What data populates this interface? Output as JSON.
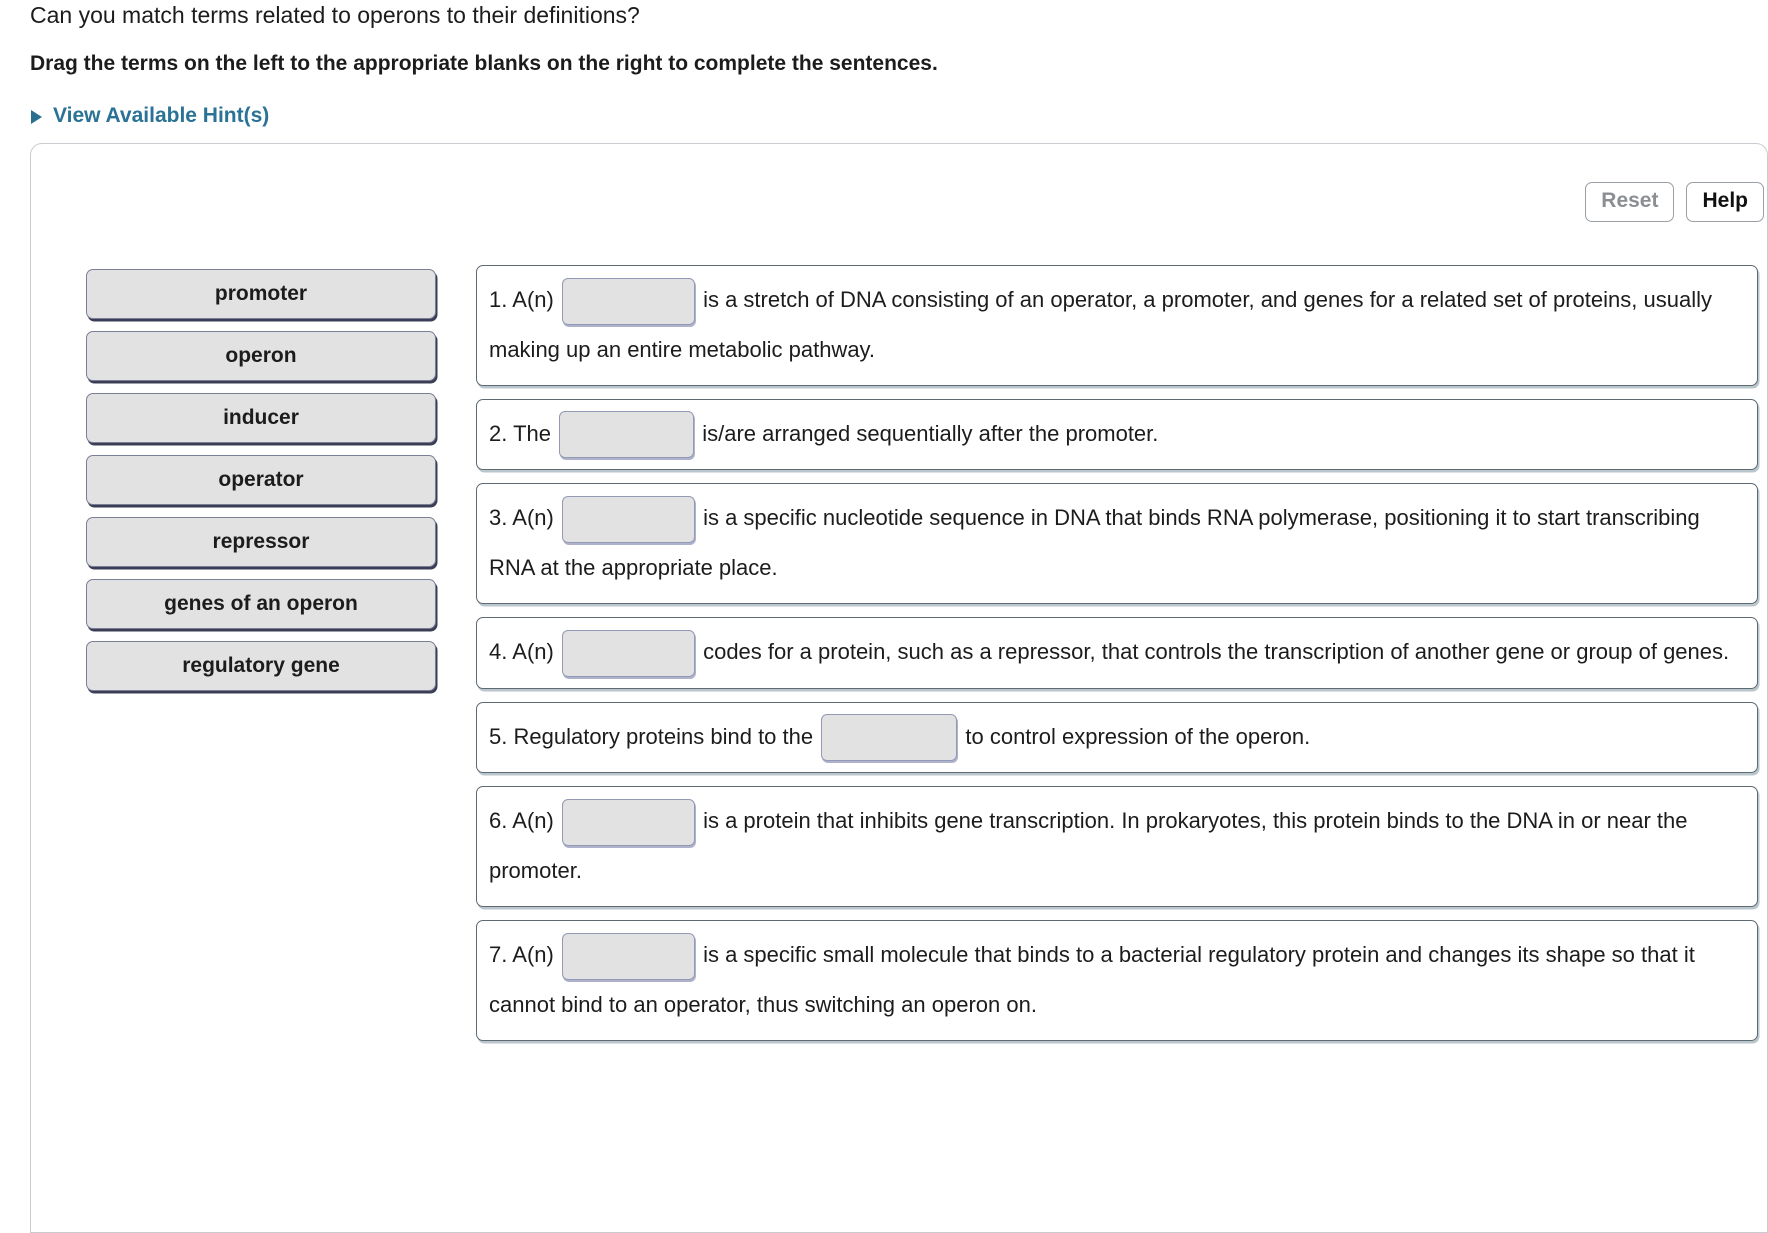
{
  "prompt": {
    "question": "Can you match terms related to operons to their definitions?",
    "instruction": "Drag the terms on the left to the appropriate blanks on the right to complete the sentences.",
    "hints_label": "View Available Hint(s)",
    "hints_caret_icon": "triangle-right-icon"
  },
  "toolbar": {
    "reset_label": "Reset",
    "help_label": "Help"
  },
  "terms": [
    {
      "label": "promoter"
    },
    {
      "label": "operon"
    },
    {
      "label": "inducer"
    },
    {
      "label": "operator"
    },
    {
      "label": "repressor"
    },
    {
      "label": "genes of an operon"
    },
    {
      "label": "regulatory gene"
    }
  ],
  "definitions": [
    {
      "number": "1.",
      "before": "A(n)",
      "after": "is a stretch of DNA consisting of an operator, a promoter, and genes for a related set of proteins, usually making up an entire metabolic pathway.",
      "slot_value": ""
    },
    {
      "number": "2.",
      "before": "The",
      "after": "is/are arranged sequentially after the promoter.",
      "slot_value": ""
    },
    {
      "number": "3.",
      "before": "A(n)",
      "after": "is a specific nucleotide sequence in DNA that binds RNA polymerase, positioning it to start transcribing RNA at the appropriate place.",
      "slot_value": ""
    },
    {
      "number": "4.",
      "before": "A(n)",
      "after": "codes for a protein, such as a repressor, that controls the transcription of another gene or group of genes.",
      "slot_value": ""
    },
    {
      "number": "5.",
      "before": "Regulatory proteins bind to the",
      "after": "to control expression of the operon.",
      "slot_value": ""
    },
    {
      "number": "6.",
      "before": "A(n)",
      "after": "is a protein that inhibits gene transcription. In prokaryotes, this protein binds to the DNA in or near the promoter.",
      "slot_value": ""
    },
    {
      "number": "7.",
      "before": "A(n)",
      "after": "is a specific small molecule that binds to a bacterial regulatory protein and changes its shape so that it cannot bind to an operator, thus switching an operon on.",
      "slot_value": ""
    }
  ],
  "colors": {
    "link": "#2a7296",
    "tile_fill": "#e2e2e2",
    "tile_border": "#7b7f96",
    "box_border": "#5f6a72",
    "text": "#1c1c1c",
    "disabled_text": "#8b8f93"
  }
}
